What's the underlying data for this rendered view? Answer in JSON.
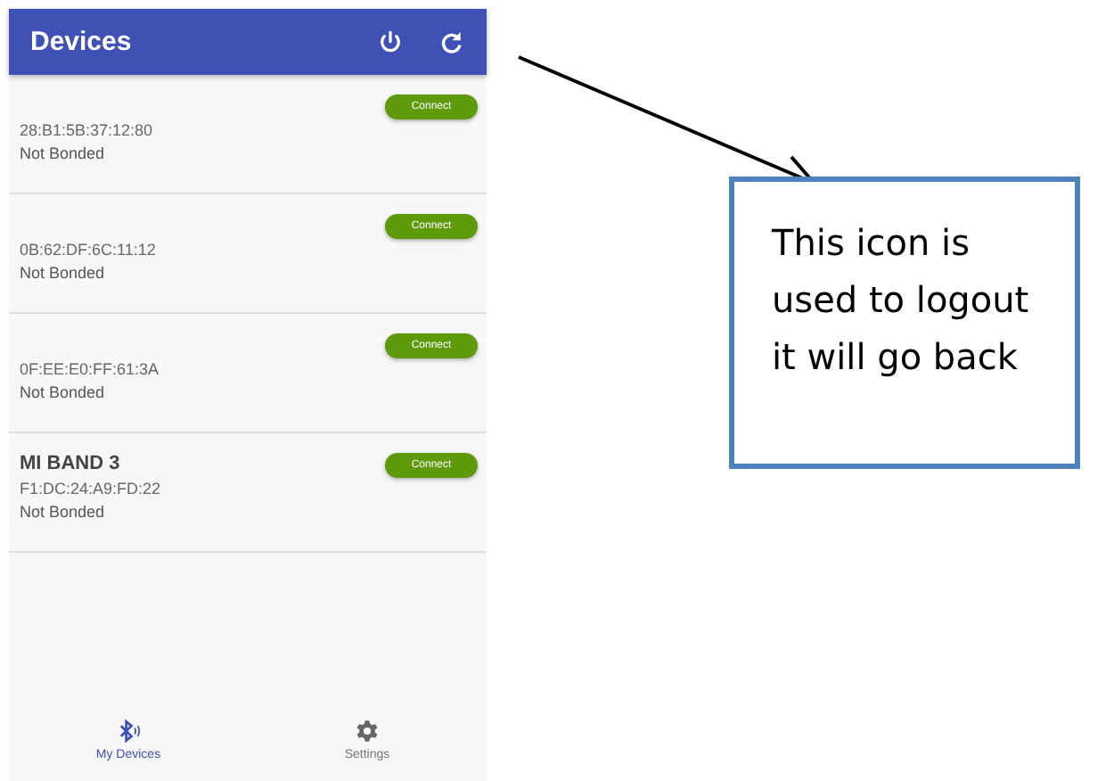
{
  "app_bar": {
    "title": "Devices"
  },
  "devices": [
    {
      "address": "28:B1:5B:37:12:80",
      "status": "Not Bonded",
      "button": "Connect"
    },
    {
      "address": "0B:62:DF:6C:11:12",
      "status": "Not Bonded",
      "button": "Connect"
    },
    {
      "address": "0F:EE:E0:FF:61:3A",
      "status": "Not Bonded",
      "button": "Connect"
    },
    {
      "name": "MI BAND 3",
      "address": "F1:DC:24:A9:FD:22",
      "status": "Not Bonded",
      "button": "Connect"
    }
  ],
  "bottom_nav": [
    {
      "kind": "bluetooth",
      "label": "My Devices",
      "selected": true
    },
    {
      "kind": "settings",
      "label": "Settings",
      "selected": false
    }
  ],
  "callout": {
    "lines": [
      "This icon is",
      "used to logout",
      "it will go back"
    ]
  }
}
